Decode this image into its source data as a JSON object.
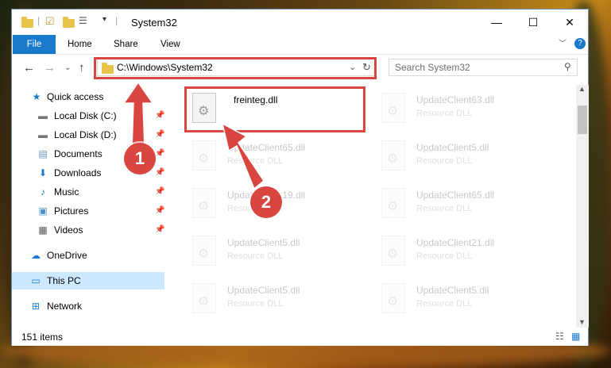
{
  "window": {
    "title": "System32",
    "controls": {
      "minimize": "—",
      "maximize": "☐",
      "close": "✕"
    }
  },
  "ribbon": {
    "tabs": [
      "File",
      "Home",
      "Share",
      "View"
    ]
  },
  "nav": {
    "address": "C:\\Windows\\System32",
    "search_placeholder": "Search System32"
  },
  "sidebar": {
    "items": [
      {
        "label": "Quick access",
        "icon": "star-icon"
      },
      {
        "label": "Local Disk (C:)",
        "icon": "drive-icon"
      },
      {
        "label": "Local Disk (D:)",
        "icon": "drive-icon"
      },
      {
        "label": "Documents",
        "icon": "documents-icon"
      },
      {
        "label": "Downloads",
        "icon": "downloads-icon"
      },
      {
        "label": "Music",
        "icon": "music-icon"
      },
      {
        "label": "Pictures",
        "icon": "pictures-icon"
      },
      {
        "label": "Videos",
        "icon": "videos-icon"
      },
      {
        "label": "OneDrive",
        "icon": "cloud-icon"
      },
      {
        "label": "This PC",
        "icon": "computer-icon"
      },
      {
        "label": "Network",
        "icon": "network-icon"
      }
    ]
  },
  "files": [
    {
      "name": "freinteg.dll",
      "type": ""
    },
    {
      "name": "UpdateClient63.dll",
      "type": "Resource DLL"
    },
    {
      "name": "UpdateClient65.dll",
      "type": "Resource DLL"
    },
    {
      "name": "UpdateClient5.dll",
      "type": "Resource DLL"
    },
    {
      "name": "UpdateClient19.dll",
      "type": "Resource DLL"
    },
    {
      "name": "UpdateClient65.dll",
      "type": "Resource DLL"
    },
    {
      "name": "UpdateClient5.dll",
      "type": "Resource DLL"
    },
    {
      "name": "UpdateClient21.dll",
      "type": "Resource DLL"
    },
    {
      "name": "UpdateClient5.dll",
      "type": "Resource DLL"
    },
    {
      "name": "UpdateClient5.dll",
      "type": "Resource DLL"
    }
  ],
  "status": {
    "count": "151 items"
  },
  "annotations": {
    "step1": "1",
    "step2": "2"
  },
  "colors": {
    "accent": "#1979ca",
    "annotation": "#d9453f",
    "selected": "#cce8ff"
  }
}
